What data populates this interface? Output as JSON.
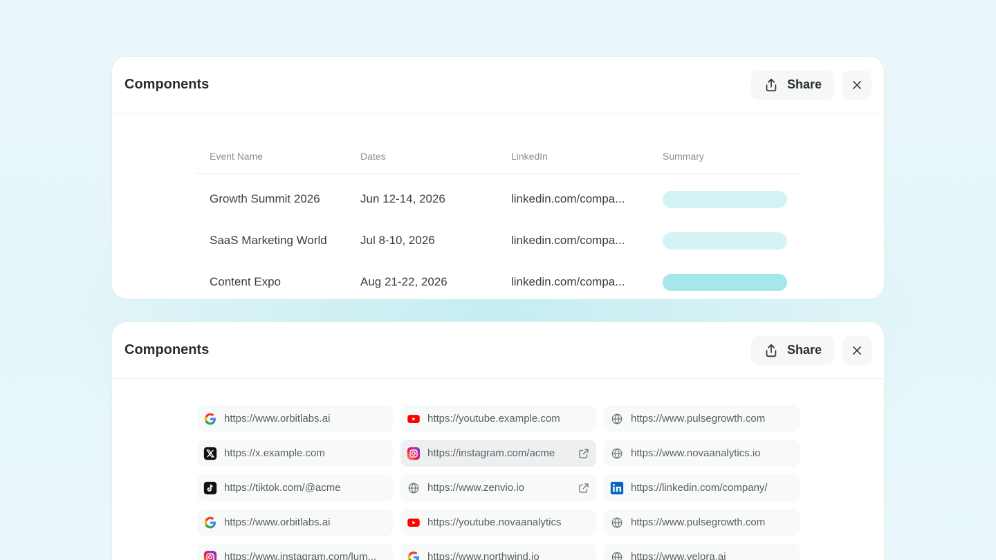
{
  "panel_top": {
    "title": "Components",
    "share_label": "Share",
    "table": {
      "columns": [
        "Event Name",
        "Dates",
        "LinkedIn",
        "Summary"
      ],
      "rows": [
        {
          "event": "Growth Summit 2026",
          "dates": "Jun 12-14, 2026",
          "linkedin": "linkedin.com/compa...",
          "summary_color": "#d3f3f5"
        },
        {
          "event": "SaaS Marketing World",
          "dates": "Jul 8-10, 2026",
          "linkedin": "linkedin.com/compa...",
          "summary_color": "#d3f3f5"
        },
        {
          "event": "Content Expo",
          "dates": "Aug 21-22, 2026",
          "linkedin": "linkedin.com/compa...",
          "summary_color": "#a5e7ea"
        }
      ]
    }
  },
  "panel_bottom": {
    "title": "Components",
    "share_label": "Share",
    "links": [
      [
        {
          "icon": "google-icon",
          "url": "https://www.orbitlabs.ai"
        },
        {
          "icon": "youtube-icon",
          "url": "https://youtube.example.com"
        },
        {
          "icon": "globe-icon",
          "url": "https://www.pulsegrowth.com"
        }
      ],
      [
        {
          "icon": "x-icon",
          "url": "https://x.example.com"
        },
        {
          "icon": "instagram-icon",
          "url": "https://instagram.com/acme"
        },
        {
          "icon": "globe-icon",
          "url": "https://www.novaanalytics.io"
        }
      ],
      [
        {
          "icon": "tiktok-icon",
          "url": "https://tiktok.com/@acme"
        },
        {
          "icon": "globe-icon",
          "url": "https://www.zenvio.io"
        },
        {
          "icon": "linkedin-icon",
          "url": "https://linkedin.com/company/"
        }
      ],
      [
        {
          "icon": "google-icon",
          "url": "https://www.orbitlabs.ai"
        },
        {
          "icon": "youtube-icon",
          "url": "https://youtube.novaanalytics"
        },
        {
          "icon": "globe-icon",
          "url": "https://www.pulsegrowth.com"
        }
      ],
      [
        {
          "icon": "instagram-icon",
          "url": "https://www.instagram.com/lum..."
        },
        {
          "icon": "google-icon",
          "url": "https://www.northwind.io"
        },
        {
          "icon": "globe-icon",
          "url": "https://www.velora.ai"
        }
      ]
    ]
  }
}
